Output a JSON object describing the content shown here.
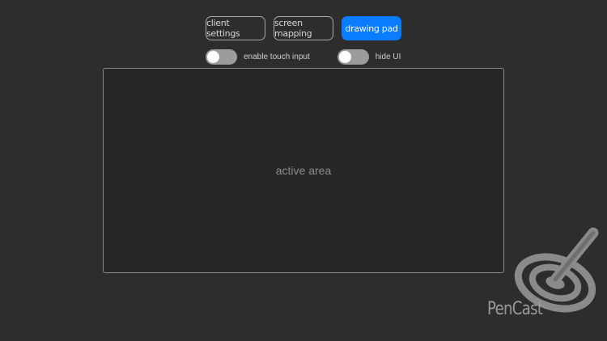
{
  "tabs": [
    {
      "label": "client settings",
      "active": false
    },
    {
      "label": "screen mapping",
      "active": false
    },
    {
      "label": "drawing pad",
      "active": true
    }
  ],
  "toggles": {
    "touch_input": {
      "label": "enable touch input",
      "on": false
    },
    "hide_ui": {
      "label": "hide UI",
      "on": false
    }
  },
  "active_area": {
    "label": "active area"
  },
  "logo": {
    "text": "PenCast",
    "icon": "pen-target-icon"
  },
  "colors": {
    "background": "#2d2d2d",
    "accent": "#0a7cff",
    "toggle_off": "#9c9c9c"
  }
}
